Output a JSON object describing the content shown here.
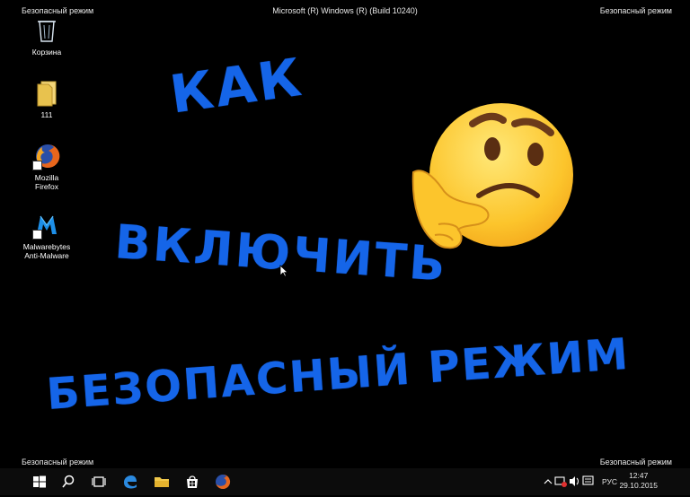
{
  "desktop": {
    "watermark_tl": "Безопасный режим",
    "watermark_tr": "Безопасный режим",
    "watermark_bl": "Безопасный режим",
    "watermark_br": "Безопасный режим",
    "build_string": "Microsoft (R) Windows (R) (Build 10240)",
    "icons": [
      {
        "label": "Корзина",
        "icon": "recycle-bin-icon"
      },
      {
        "label": "111",
        "icon": "folder-icon"
      },
      {
        "label_line1": "Mozilla",
        "label_line2": "Firefox",
        "icon": "firefox-icon"
      },
      {
        "label_line1": "Malwarebytes",
        "label_line2": "Anti-Malware",
        "icon": "malwarebytes-icon"
      }
    ]
  },
  "overlay": {
    "line1": "КАК",
    "line2": "ВКЛЮЧИТЬ",
    "line3": "БЕЗОПАСНЫЙ РЕЖИМ",
    "emoji": "thinking-face-icon",
    "text_color": "#1565e8"
  },
  "taskbar": {
    "buttons": [
      "start-icon",
      "search-icon",
      "task-view-icon",
      "edge-icon",
      "file-explorer-icon",
      "store-icon",
      "firefox-icon"
    ],
    "language": "РУС",
    "time": "12:47",
    "date": "29.10.2015"
  }
}
